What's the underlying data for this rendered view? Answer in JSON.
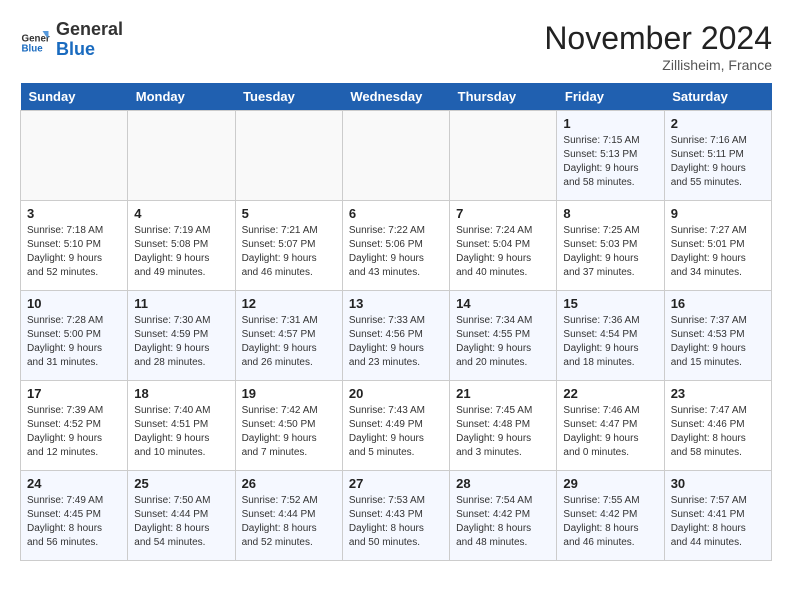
{
  "logo": {
    "text_general": "General",
    "text_blue": "Blue"
  },
  "header": {
    "month": "November 2024",
    "location": "Zillisheim, France"
  },
  "weekdays": [
    "Sunday",
    "Monday",
    "Tuesday",
    "Wednesday",
    "Thursday",
    "Friday",
    "Saturday"
  ],
  "weeks": [
    [
      {
        "day": "",
        "info": ""
      },
      {
        "day": "",
        "info": ""
      },
      {
        "day": "",
        "info": ""
      },
      {
        "day": "",
        "info": ""
      },
      {
        "day": "",
        "info": ""
      },
      {
        "day": "1",
        "info": "Sunrise: 7:15 AM\nSunset: 5:13 PM\nDaylight: 9 hours and 58 minutes."
      },
      {
        "day": "2",
        "info": "Sunrise: 7:16 AM\nSunset: 5:11 PM\nDaylight: 9 hours and 55 minutes."
      }
    ],
    [
      {
        "day": "3",
        "info": "Sunrise: 7:18 AM\nSunset: 5:10 PM\nDaylight: 9 hours and 52 minutes."
      },
      {
        "day": "4",
        "info": "Sunrise: 7:19 AM\nSunset: 5:08 PM\nDaylight: 9 hours and 49 minutes."
      },
      {
        "day": "5",
        "info": "Sunrise: 7:21 AM\nSunset: 5:07 PM\nDaylight: 9 hours and 46 minutes."
      },
      {
        "day": "6",
        "info": "Sunrise: 7:22 AM\nSunset: 5:06 PM\nDaylight: 9 hours and 43 minutes."
      },
      {
        "day": "7",
        "info": "Sunrise: 7:24 AM\nSunset: 5:04 PM\nDaylight: 9 hours and 40 minutes."
      },
      {
        "day": "8",
        "info": "Sunrise: 7:25 AM\nSunset: 5:03 PM\nDaylight: 9 hours and 37 minutes."
      },
      {
        "day": "9",
        "info": "Sunrise: 7:27 AM\nSunset: 5:01 PM\nDaylight: 9 hours and 34 minutes."
      }
    ],
    [
      {
        "day": "10",
        "info": "Sunrise: 7:28 AM\nSunset: 5:00 PM\nDaylight: 9 hours and 31 minutes."
      },
      {
        "day": "11",
        "info": "Sunrise: 7:30 AM\nSunset: 4:59 PM\nDaylight: 9 hours and 28 minutes."
      },
      {
        "day": "12",
        "info": "Sunrise: 7:31 AM\nSunset: 4:57 PM\nDaylight: 9 hours and 26 minutes."
      },
      {
        "day": "13",
        "info": "Sunrise: 7:33 AM\nSunset: 4:56 PM\nDaylight: 9 hours and 23 minutes."
      },
      {
        "day": "14",
        "info": "Sunrise: 7:34 AM\nSunset: 4:55 PM\nDaylight: 9 hours and 20 minutes."
      },
      {
        "day": "15",
        "info": "Sunrise: 7:36 AM\nSunset: 4:54 PM\nDaylight: 9 hours and 18 minutes."
      },
      {
        "day": "16",
        "info": "Sunrise: 7:37 AM\nSunset: 4:53 PM\nDaylight: 9 hours and 15 minutes."
      }
    ],
    [
      {
        "day": "17",
        "info": "Sunrise: 7:39 AM\nSunset: 4:52 PM\nDaylight: 9 hours and 12 minutes."
      },
      {
        "day": "18",
        "info": "Sunrise: 7:40 AM\nSunset: 4:51 PM\nDaylight: 9 hours and 10 minutes."
      },
      {
        "day": "19",
        "info": "Sunrise: 7:42 AM\nSunset: 4:50 PM\nDaylight: 9 hours and 7 minutes."
      },
      {
        "day": "20",
        "info": "Sunrise: 7:43 AM\nSunset: 4:49 PM\nDaylight: 9 hours and 5 minutes."
      },
      {
        "day": "21",
        "info": "Sunrise: 7:45 AM\nSunset: 4:48 PM\nDaylight: 9 hours and 3 minutes."
      },
      {
        "day": "22",
        "info": "Sunrise: 7:46 AM\nSunset: 4:47 PM\nDaylight: 9 hours and 0 minutes."
      },
      {
        "day": "23",
        "info": "Sunrise: 7:47 AM\nSunset: 4:46 PM\nDaylight: 8 hours and 58 minutes."
      }
    ],
    [
      {
        "day": "24",
        "info": "Sunrise: 7:49 AM\nSunset: 4:45 PM\nDaylight: 8 hours and 56 minutes."
      },
      {
        "day": "25",
        "info": "Sunrise: 7:50 AM\nSunset: 4:44 PM\nDaylight: 8 hours and 54 minutes."
      },
      {
        "day": "26",
        "info": "Sunrise: 7:52 AM\nSunset: 4:44 PM\nDaylight: 8 hours and 52 minutes."
      },
      {
        "day": "27",
        "info": "Sunrise: 7:53 AM\nSunset: 4:43 PM\nDaylight: 8 hours and 50 minutes."
      },
      {
        "day": "28",
        "info": "Sunrise: 7:54 AM\nSunset: 4:42 PM\nDaylight: 8 hours and 48 minutes."
      },
      {
        "day": "29",
        "info": "Sunrise: 7:55 AM\nSunset: 4:42 PM\nDaylight: 8 hours and 46 minutes."
      },
      {
        "day": "30",
        "info": "Sunrise: 7:57 AM\nSunset: 4:41 PM\nDaylight: 8 hours and 44 minutes."
      }
    ]
  ]
}
